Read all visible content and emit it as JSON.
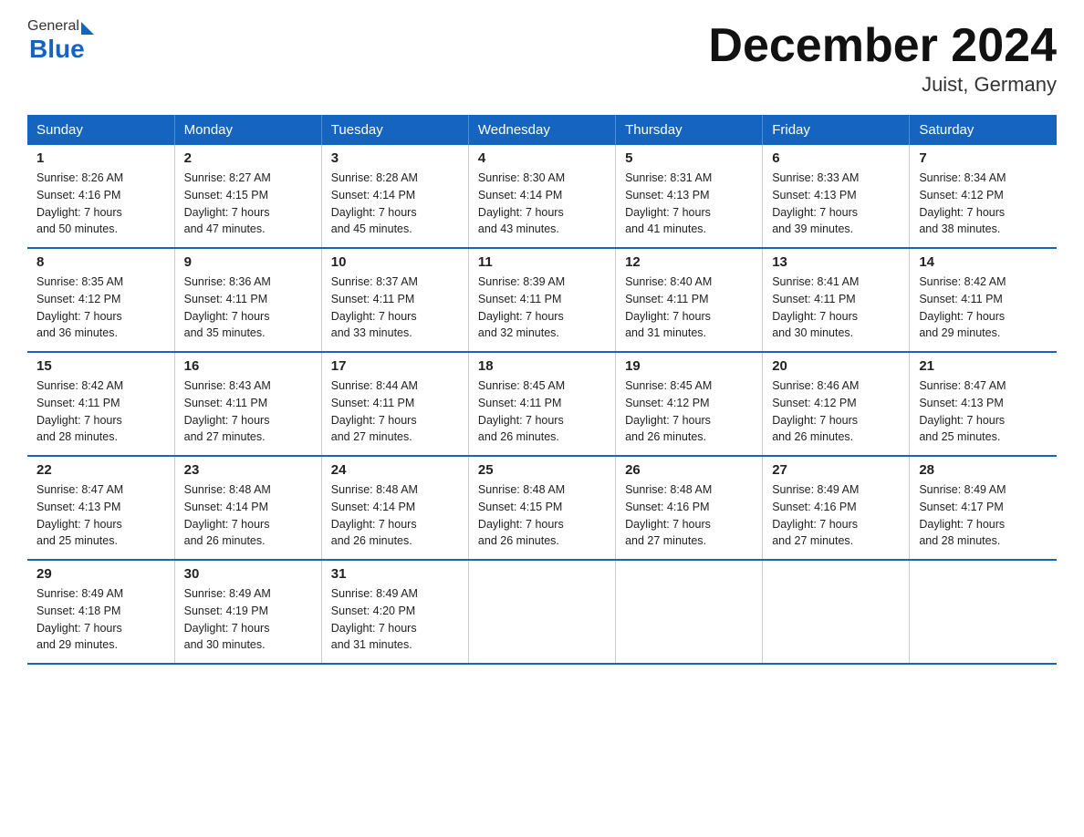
{
  "header": {
    "logo_general": "General",
    "logo_blue": "Blue",
    "title": "December 2024",
    "subtitle": "Juist, Germany"
  },
  "weekdays": [
    "Sunday",
    "Monday",
    "Tuesday",
    "Wednesday",
    "Thursday",
    "Friday",
    "Saturday"
  ],
  "weeks": [
    [
      {
        "day": "1",
        "info": "Sunrise: 8:26 AM\nSunset: 4:16 PM\nDaylight: 7 hours\nand 50 minutes."
      },
      {
        "day": "2",
        "info": "Sunrise: 8:27 AM\nSunset: 4:15 PM\nDaylight: 7 hours\nand 47 minutes."
      },
      {
        "day": "3",
        "info": "Sunrise: 8:28 AM\nSunset: 4:14 PM\nDaylight: 7 hours\nand 45 minutes."
      },
      {
        "day": "4",
        "info": "Sunrise: 8:30 AM\nSunset: 4:14 PM\nDaylight: 7 hours\nand 43 minutes."
      },
      {
        "day": "5",
        "info": "Sunrise: 8:31 AM\nSunset: 4:13 PM\nDaylight: 7 hours\nand 41 minutes."
      },
      {
        "day": "6",
        "info": "Sunrise: 8:33 AM\nSunset: 4:13 PM\nDaylight: 7 hours\nand 39 minutes."
      },
      {
        "day": "7",
        "info": "Sunrise: 8:34 AM\nSunset: 4:12 PM\nDaylight: 7 hours\nand 38 minutes."
      }
    ],
    [
      {
        "day": "8",
        "info": "Sunrise: 8:35 AM\nSunset: 4:12 PM\nDaylight: 7 hours\nand 36 minutes."
      },
      {
        "day": "9",
        "info": "Sunrise: 8:36 AM\nSunset: 4:11 PM\nDaylight: 7 hours\nand 35 minutes."
      },
      {
        "day": "10",
        "info": "Sunrise: 8:37 AM\nSunset: 4:11 PM\nDaylight: 7 hours\nand 33 minutes."
      },
      {
        "day": "11",
        "info": "Sunrise: 8:39 AM\nSunset: 4:11 PM\nDaylight: 7 hours\nand 32 minutes."
      },
      {
        "day": "12",
        "info": "Sunrise: 8:40 AM\nSunset: 4:11 PM\nDaylight: 7 hours\nand 31 minutes."
      },
      {
        "day": "13",
        "info": "Sunrise: 8:41 AM\nSunset: 4:11 PM\nDaylight: 7 hours\nand 30 minutes."
      },
      {
        "day": "14",
        "info": "Sunrise: 8:42 AM\nSunset: 4:11 PM\nDaylight: 7 hours\nand 29 minutes."
      }
    ],
    [
      {
        "day": "15",
        "info": "Sunrise: 8:42 AM\nSunset: 4:11 PM\nDaylight: 7 hours\nand 28 minutes."
      },
      {
        "day": "16",
        "info": "Sunrise: 8:43 AM\nSunset: 4:11 PM\nDaylight: 7 hours\nand 27 minutes."
      },
      {
        "day": "17",
        "info": "Sunrise: 8:44 AM\nSunset: 4:11 PM\nDaylight: 7 hours\nand 27 minutes."
      },
      {
        "day": "18",
        "info": "Sunrise: 8:45 AM\nSunset: 4:11 PM\nDaylight: 7 hours\nand 26 minutes."
      },
      {
        "day": "19",
        "info": "Sunrise: 8:45 AM\nSunset: 4:12 PM\nDaylight: 7 hours\nand 26 minutes."
      },
      {
        "day": "20",
        "info": "Sunrise: 8:46 AM\nSunset: 4:12 PM\nDaylight: 7 hours\nand 26 minutes."
      },
      {
        "day": "21",
        "info": "Sunrise: 8:47 AM\nSunset: 4:13 PM\nDaylight: 7 hours\nand 25 minutes."
      }
    ],
    [
      {
        "day": "22",
        "info": "Sunrise: 8:47 AM\nSunset: 4:13 PM\nDaylight: 7 hours\nand 25 minutes."
      },
      {
        "day": "23",
        "info": "Sunrise: 8:48 AM\nSunset: 4:14 PM\nDaylight: 7 hours\nand 26 minutes."
      },
      {
        "day": "24",
        "info": "Sunrise: 8:48 AM\nSunset: 4:14 PM\nDaylight: 7 hours\nand 26 minutes."
      },
      {
        "day": "25",
        "info": "Sunrise: 8:48 AM\nSunset: 4:15 PM\nDaylight: 7 hours\nand 26 minutes."
      },
      {
        "day": "26",
        "info": "Sunrise: 8:48 AM\nSunset: 4:16 PM\nDaylight: 7 hours\nand 27 minutes."
      },
      {
        "day": "27",
        "info": "Sunrise: 8:49 AM\nSunset: 4:16 PM\nDaylight: 7 hours\nand 27 minutes."
      },
      {
        "day": "28",
        "info": "Sunrise: 8:49 AM\nSunset: 4:17 PM\nDaylight: 7 hours\nand 28 minutes."
      }
    ],
    [
      {
        "day": "29",
        "info": "Sunrise: 8:49 AM\nSunset: 4:18 PM\nDaylight: 7 hours\nand 29 minutes."
      },
      {
        "day": "30",
        "info": "Sunrise: 8:49 AM\nSunset: 4:19 PM\nDaylight: 7 hours\nand 30 minutes."
      },
      {
        "day": "31",
        "info": "Sunrise: 8:49 AM\nSunset: 4:20 PM\nDaylight: 7 hours\nand 31 minutes."
      },
      {
        "day": "",
        "info": ""
      },
      {
        "day": "",
        "info": ""
      },
      {
        "day": "",
        "info": ""
      },
      {
        "day": "",
        "info": ""
      }
    ]
  ]
}
